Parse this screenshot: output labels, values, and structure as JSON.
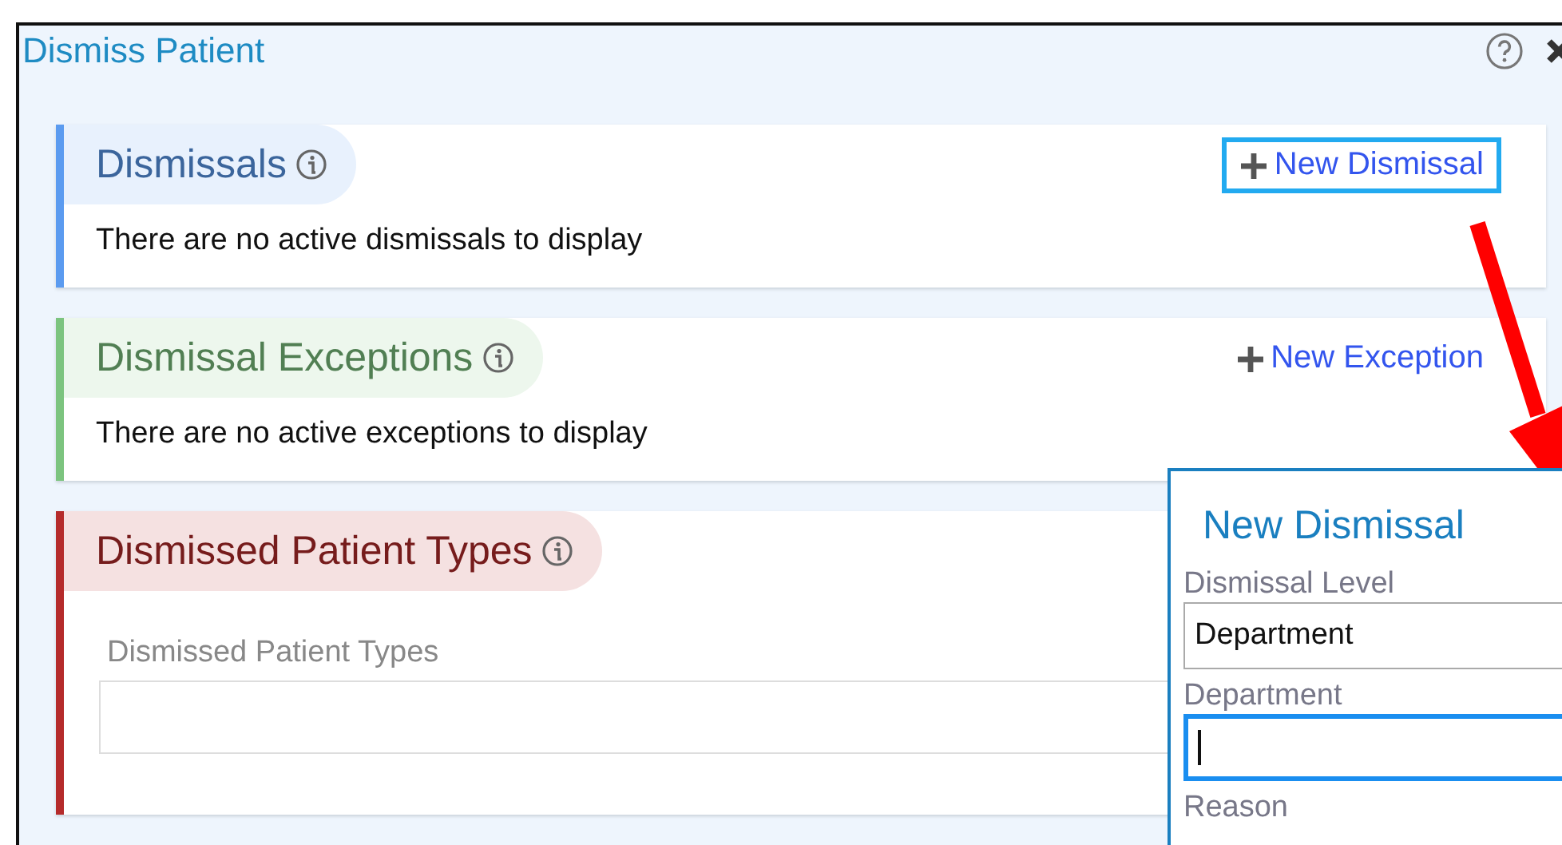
{
  "window": {
    "title": "Dismiss Patient"
  },
  "sections": [
    {
      "title": "Dismissals",
      "color": "#5b9bf0",
      "message": "There are no active dismissals to display",
      "action": {
        "label": "New Dismissal",
        "focused": true
      }
    },
    {
      "title": "Dismissal Exceptions",
      "color": "#7cc47f",
      "message": "There are no active exceptions to display",
      "action": {
        "label": "New Exception",
        "focused": false
      }
    },
    {
      "title": "Dismissed Patient Types",
      "color": "#b52b2b",
      "field": {
        "label": "Dismissed Patient Types"
      }
    }
  ],
  "popup": {
    "title": "New Dismissal",
    "fields": [
      {
        "label": "Dismissal Level",
        "kind": "select",
        "value": "Department",
        "focused": false
      },
      {
        "label": "Department",
        "kind": "text",
        "focused": true
      },
      {
        "label": "Reason",
        "kind": "label"
      }
    ]
  }
}
